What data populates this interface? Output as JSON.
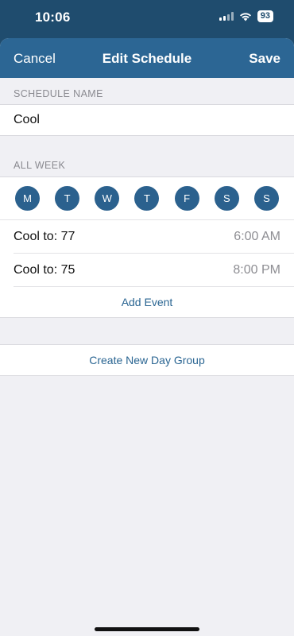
{
  "status": {
    "time": "10:06",
    "battery": "93"
  },
  "nav": {
    "cancel_label": "Cancel",
    "title": "Edit Schedule",
    "save_label": "Save"
  },
  "schedule_name": {
    "header": "SCHEDULE NAME",
    "value": "Cool"
  },
  "all_week": {
    "header": "ALL WEEK",
    "days": [
      "M",
      "T",
      "W",
      "T",
      "F",
      "S",
      "S"
    ],
    "events": [
      {
        "label": "Cool to: 77",
        "time": "6:00 AM"
      },
      {
        "label": "Cool to: 75",
        "time": "8:00 PM"
      }
    ],
    "add_event_label": "Add Event"
  },
  "create_group_label": "Create New Day Group",
  "colors": {
    "nav_bg": "#2c6694",
    "day_circle": "#2b618e",
    "link": "#2a6592"
  }
}
